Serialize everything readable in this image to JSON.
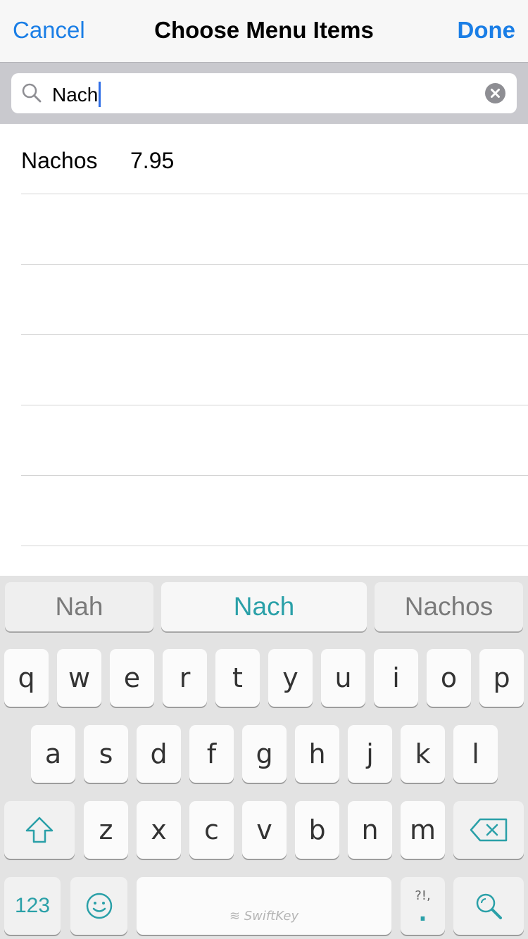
{
  "navbar": {
    "cancel_label": "Cancel",
    "title": "Choose Menu Items",
    "done_label": "Done"
  },
  "search": {
    "value": "Nach"
  },
  "results": [
    {
      "name": "Nachos",
      "price": "7.95"
    }
  ],
  "keyboard": {
    "predictions": [
      "Nah",
      "Nach",
      "Nachos"
    ],
    "row1": [
      "q",
      "w",
      "e",
      "r",
      "t",
      "y",
      "u",
      "i",
      "o",
      "p"
    ],
    "row2": [
      "a",
      "s",
      "d",
      "f",
      "g",
      "h",
      "j",
      "k",
      "l"
    ],
    "row3": [
      "z",
      "x",
      "c",
      "v",
      "b",
      "n",
      "m"
    ],
    "numbers_label": "123",
    "space_brand": "SwiftKey",
    "punct_top": "?!,",
    "punct_bottom": "."
  },
  "colors": {
    "accent": "#1a7ee6",
    "keyboard_accent": "#2aa0a8"
  }
}
